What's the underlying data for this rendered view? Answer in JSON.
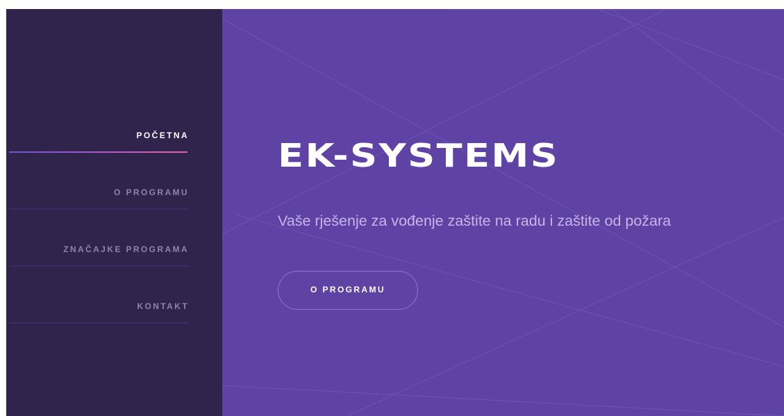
{
  "sidebar": {
    "items": [
      {
        "label": "POČETNA",
        "active": true
      },
      {
        "label": "O PROGRAMU",
        "active": false
      },
      {
        "label": "ZNAČAJKE PROGRAMA",
        "active": false
      },
      {
        "label": "KONTAKT",
        "active": false
      }
    ]
  },
  "hero": {
    "brand": "EK-SYSTEMS",
    "tagline": "Vaše rješenje za vođenje zaštite na radu i zaštite od požara",
    "cta_label": "O PROGRAMU"
  },
  "colors": {
    "sidebar_bg": "#30244d",
    "main_bg": "#5e43a5",
    "accent_gradient_start": "#6f52d6",
    "accent_gradient_end": "#e0689e"
  }
}
